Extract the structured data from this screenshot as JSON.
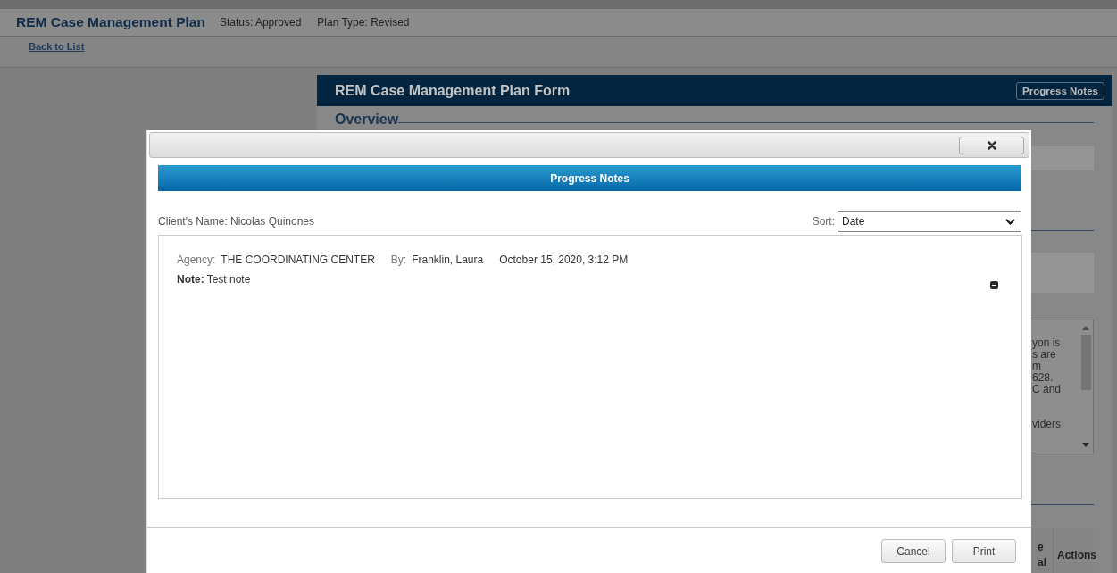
{
  "header": {
    "title": "REM Case Management Plan",
    "status": "Status: Approved",
    "plan_type": "Plan Type: Revised"
  },
  "back_link": "Back to List",
  "form": {
    "title": "REM Case Management Plan Form",
    "progress_notes_button": "Progress Notes",
    "overview_legend": "Overview",
    "textarea_fragments": [
      "yon is",
      "s are",
      "m",
      "628.",
      "C and",
      "viders"
    ],
    "table_columns": [
      {
        "lines": [
          "e",
          "al"
        ]
      },
      {
        "lines": [
          "Actions"
        ]
      }
    ]
  },
  "dialog": {
    "title": "Progress Notes",
    "client_name": "Client's Name: Nicolas Quinones",
    "sort": {
      "label": "Sort:",
      "value": "Date"
    },
    "notes": [
      {
        "agency_label": "Agency:",
        "agency": "THE COORDINATING CENTER",
        "by_label": "By:",
        "author": "Franklin, Laura",
        "date": "October 15, 2020, 3:12 PM",
        "note_label": "Note:",
        "note": "Test note"
      }
    ],
    "buttons": [
      "Cancel",
      "Print"
    ]
  }
}
